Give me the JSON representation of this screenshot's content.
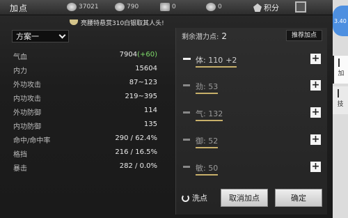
{
  "header": {
    "title": "加点",
    "currencies": [
      {
        "icon": "coin-icon",
        "value": "37021"
      },
      {
        "icon": "silver-icon",
        "value": "790"
      },
      {
        "icon": "token-icon",
        "value": "0"
      },
      {
        "icon": "ingot-icon",
        "value": "0"
      }
    ],
    "jifen_label": "积分"
  },
  "notice": {
    "text": "亮腰特悬赏310白银取其人头!"
  },
  "scheme": {
    "label": "方案一"
  },
  "stats": [
    {
      "name": "气血",
      "value": "7904",
      "bonus": "(+60)"
    },
    {
      "name": "内力",
      "value": "15604",
      "bonus": ""
    },
    {
      "name": "外功攻击",
      "value": "87~123",
      "bonus": ""
    },
    {
      "name": "内功攻击",
      "value": "219~395",
      "bonus": ""
    },
    {
      "name": "外功防御",
      "value": "114",
      "bonus": ""
    },
    {
      "name": "内功防御",
      "value": "135",
      "bonus": ""
    },
    {
      "name": "命中/命中率",
      "value": "290 / 62.4%",
      "bonus": ""
    },
    {
      "name": "格挡",
      "value": "216 / 16.5%",
      "bonus": ""
    },
    {
      "name": "暴击",
      "value": "282 / 0.0%",
      "bonus": ""
    }
  ],
  "points": {
    "label": "剩余潜力点:",
    "value": "2"
  },
  "recommend_label": "推荐加点",
  "attributes": [
    {
      "name": "体",
      "value": "110",
      "bonus": "+2",
      "active": true
    },
    {
      "name": "劲",
      "value": "53",
      "bonus": "",
      "active": false
    },
    {
      "name": "气",
      "value": "132",
      "bonus": "",
      "active": false
    },
    {
      "name": "御",
      "value": "52",
      "bonus": "",
      "active": false
    },
    {
      "name": "敏",
      "value": "50",
      "bonus": "",
      "active": false
    }
  ],
  "buttons": {
    "wash": "洗点",
    "cancel": "取消加点",
    "confirm": "确定"
  },
  "side": {
    "top_text": "3.40",
    "tabs": [
      "加",
      "技"
    ]
  },
  "colors": {
    "accent_gold": "#c8b06a",
    "bonus_green": "#7fdc6a",
    "side_blue": "#4d8fe0"
  }
}
